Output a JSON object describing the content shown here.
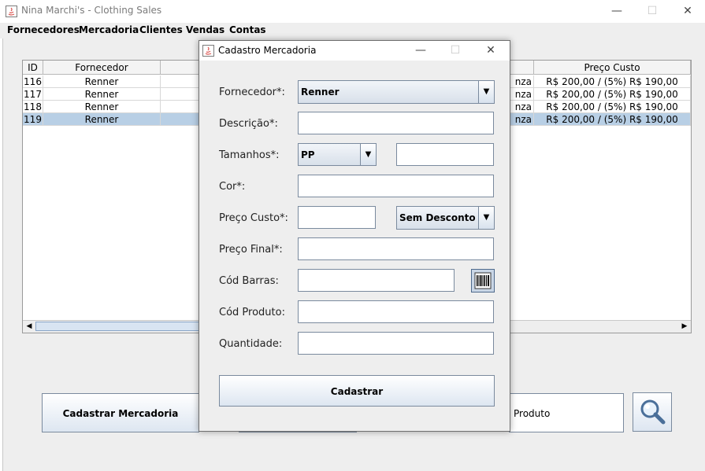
{
  "main_window": {
    "title": "Nina Marchi's - Clothing Sales",
    "controls": {
      "minimize": "—",
      "maximize": "☐",
      "close": "✕"
    },
    "menu": [
      "Fornecedores",
      "Mercadoria",
      "Clientes",
      "Vendas",
      "Contas"
    ]
  },
  "table": {
    "headers": {
      "id": "ID",
      "supplier": "Fornecedor",
      "cost": "Preço Custo"
    },
    "rows": [
      {
        "id": "116",
        "supplier": "Renner",
        "frag": "nza",
        "cost": "R$ 200,00 / (5%) R$ 190,00"
      },
      {
        "id": "117",
        "supplier": "Renner",
        "frag": "nza",
        "cost": "R$ 200,00 / (5%) R$ 190,00"
      },
      {
        "id": "118",
        "supplier": "Renner",
        "frag": "nza",
        "cost": "R$ 200,00 / (5%) R$ 190,00"
      },
      {
        "id": "119",
        "supplier": "Renner",
        "frag": "nza",
        "cost": "R$ 200,00 / (5%) R$ 190,00"
      }
    ],
    "selected_row": "119"
  },
  "bottom": {
    "register_button": "Cadastrar Mercadoria",
    "product_partial": "Produto",
    "search_icon": "magnifier-icon"
  },
  "dialog": {
    "title": "Cadastro Mercadoria",
    "controls": {
      "minimize": "—",
      "maximize": "☐",
      "close": "✕"
    },
    "labels": {
      "supplier": "Fornecedor*:",
      "description": "Descrição*:",
      "sizes": "Tamanhos*:",
      "color": "Cor*:",
      "cost_price": "Preço Custo*:",
      "final_price": "Preço Final*:",
      "barcode": "Cód Barras:",
      "product_code": "Cód Produto:",
      "quantity": "Quantidade:"
    },
    "values": {
      "supplier": "Renner",
      "description": "",
      "size": "PP",
      "size_extra": "",
      "color": "",
      "cost_price": "",
      "discount": "Sem Desconto",
      "final_price": "",
      "barcode": "",
      "product_code": "",
      "quantity": ""
    },
    "barcode_icon": "barcode-icon",
    "submit": "Cadastrar"
  },
  "colors": {
    "selection": "#b8cfe5",
    "button_gradient_end": "#dde6f1",
    "border": "#7a8a9e"
  }
}
